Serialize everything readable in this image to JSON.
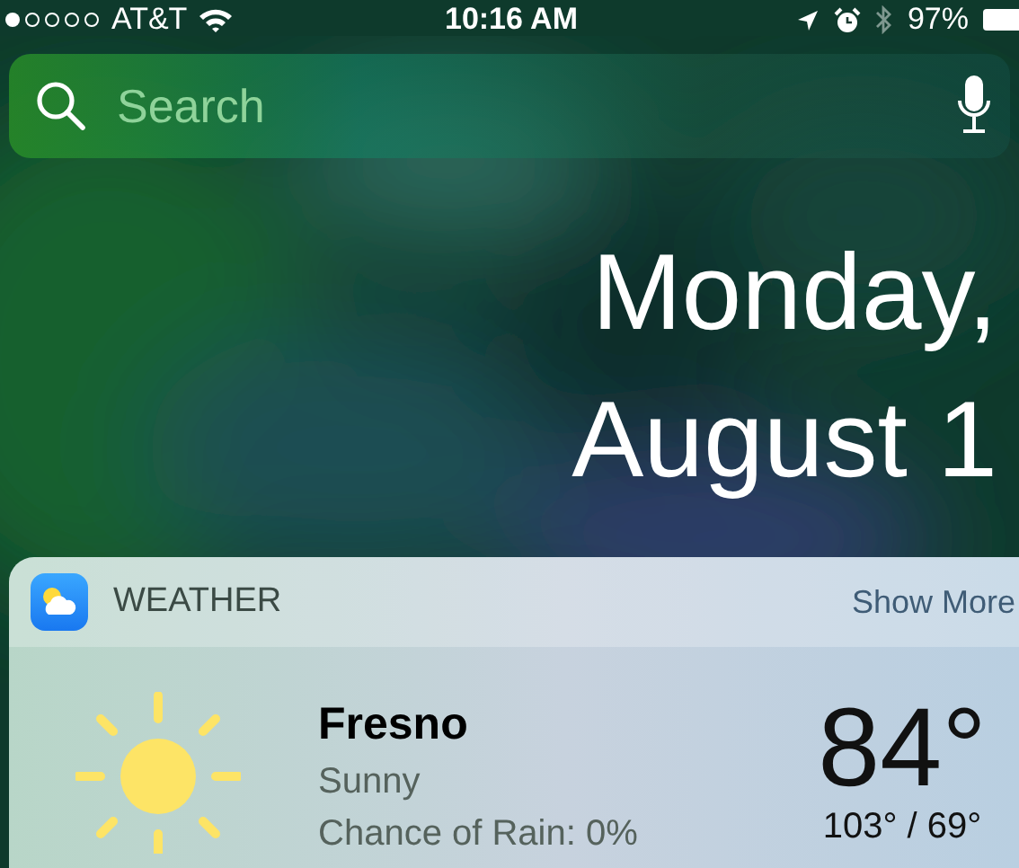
{
  "status_bar": {
    "carrier": "AT&T",
    "time": "10:16 AM",
    "bluetooth_on": false,
    "battery": "97%"
  },
  "search": {
    "placeholder": "Search"
  },
  "date": {
    "weekday": "Monday,",
    "day": "August 1"
  },
  "widget": {
    "title": "WEATHER",
    "action": "Show More",
    "city": "Fresno",
    "condition": "Sunny",
    "rain": "Chance of Rain: 0%",
    "temperature": "84°",
    "range": "103° / 69°"
  }
}
